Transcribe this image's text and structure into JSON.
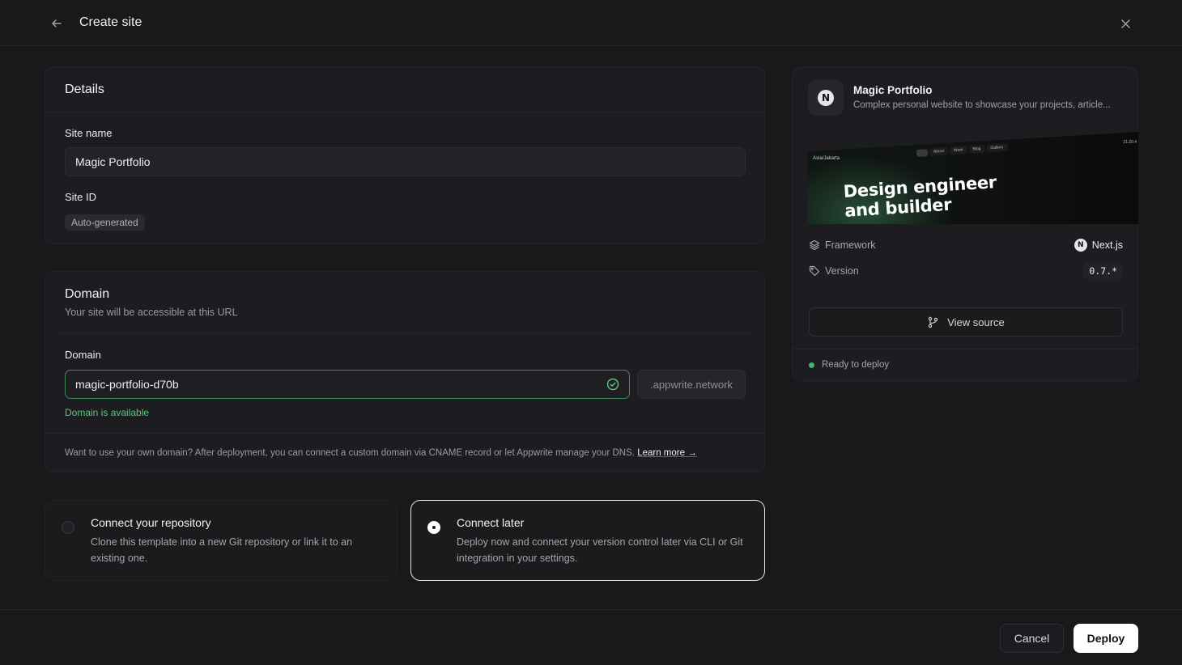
{
  "header": {
    "title": "Create site"
  },
  "details": {
    "title": "Details",
    "site_name_label": "Site name",
    "site_name_value": "Magic Portfolio",
    "site_id_label": "Site ID",
    "site_id_badge": "Auto-generated"
  },
  "domain": {
    "title": "Domain",
    "subtitle": "Your site will be accessible at this URL",
    "field_label": "Domain",
    "field_value": "magic-portfolio-d70b",
    "suffix": ".appwrite.network",
    "status": "Domain is available",
    "footnote": "Want to use your own domain? After deployment, you can connect a custom domain via CNAME record or let Appwrite manage your DNS.",
    "learn_more": "Learn more →"
  },
  "connect_options": [
    {
      "title": "Connect your repository",
      "description": "Clone this template into a new Git repository or link it to an existing one.",
      "selected": false
    },
    {
      "title": "Connect later",
      "description": "Deploy now and connect your version control later via CLI or Git integration in your settings.",
      "selected": true
    }
  ],
  "template": {
    "name": "Magic Portfolio",
    "description": "Complex personal website to showcase your projects, article...",
    "logo_letter": "N",
    "preview": {
      "brand": "Asia/Jakarta",
      "nav": [
        "",
        "About",
        "Work",
        "Blog",
        "Gallery"
      ],
      "time": "21:20:4",
      "headline_line1": "Design engineer",
      "headline_line2": "and builder"
    },
    "framework_label": "Framework",
    "framework_value": "Next.js",
    "version_label": "Version",
    "version_value": "0.7.*",
    "view_source": "View source",
    "status": "Ready to deploy"
  },
  "footer": {
    "cancel": "Cancel",
    "deploy": "Deploy"
  },
  "colors": {
    "accent_success": "#5fc47f",
    "status_dot": "#46b16a",
    "background": "#19191c"
  }
}
